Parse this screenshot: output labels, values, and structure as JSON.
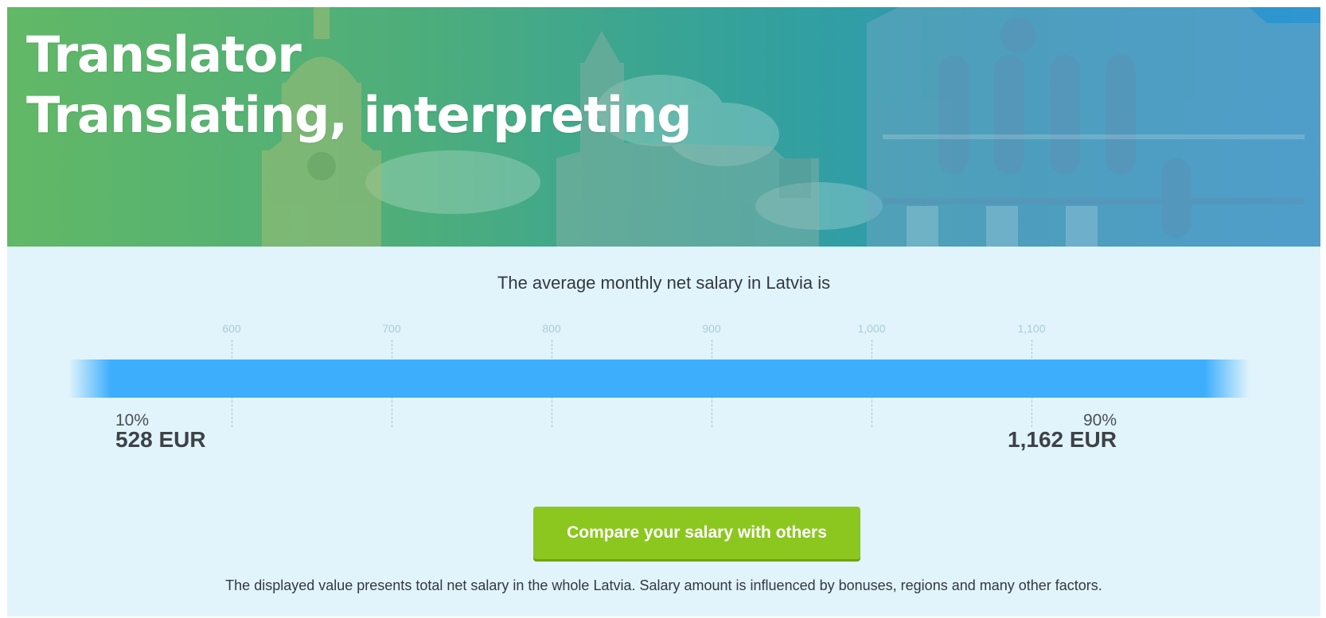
{
  "hero": {
    "title_line1": "Translator",
    "title_line2": "Translating, interpreting"
  },
  "salary": {
    "subtitle": "The average monthly net salary in Latvia is",
    "axis_ticks": [
      "600",
      "700",
      "800",
      "900",
      "1,000",
      "1,100"
    ],
    "low": {
      "percentile": "10%",
      "amount": "528 EUR"
    },
    "high": {
      "percentile": "90%",
      "amount": "1,162 EUR"
    },
    "bar_color": "#3daefc"
  },
  "compare_button": {
    "label": "Compare your salary with others"
  },
  "footer_note": "The displayed value presents total net salary in the whole Latvia. Salary amount is influenced by bonuses, regions and many other factors.",
  "colors": {
    "section_background": "#e1f4fb",
    "button_green": "#8cc720",
    "hero_gradient_start": "#62b866",
    "hero_gradient_end": "#2f96d2"
  }
}
